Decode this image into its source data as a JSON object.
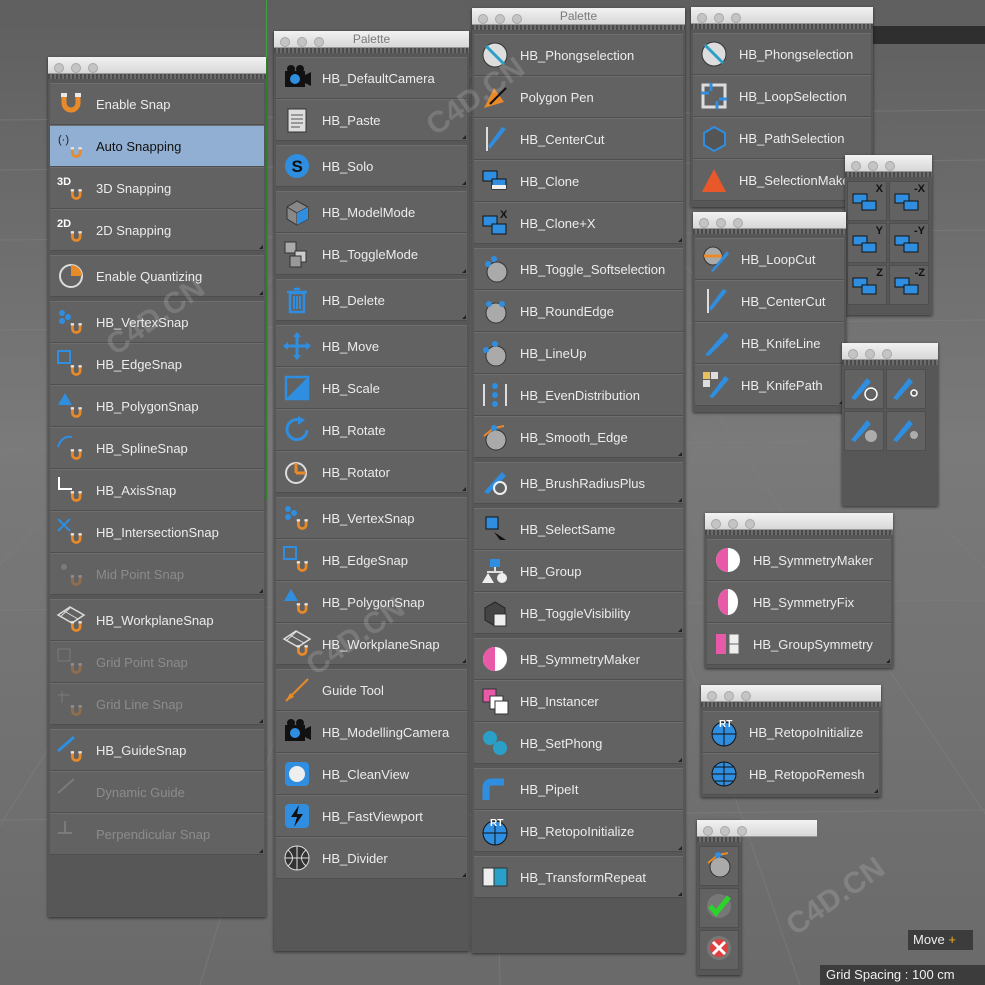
{
  "colors": {
    "panel": "#575757",
    "button": "#626262",
    "selected": "#91aed3",
    "label": "#ececec",
    "disabled": "#8c8c8c",
    "viewport": "#6e6e6e",
    "titlebar": "#e6e6e6"
  },
  "palettes": {
    "snap": {
      "groups": [
        [
          {
            "label": "Enable Snap",
            "icon": "magnet-icon"
          },
          {
            "label": "Auto Snapping",
            "icon": "auto-snap-icon",
            "selected": true
          },
          {
            "label": "3D Snapping",
            "icon": "snap-3d-icon"
          },
          {
            "label": "2D Snapping",
            "icon": "snap-2d-icon"
          }
        ],
        [
          {
            "label": "Enable Quantizing",
            "icon": "quantize-icon"
          }
        ],
        [
          {
            "label": "HB_VertexSnap",
            "icon": "vertex-snap-icon"
          },
          {
            "label": "HB_EdgeSnap",
            "icon": "edge-snap-icon"
          },
          {
            "label": "HB_PolygonSnap",
            "icon": "polygon-snap-icon"
          },
          {
            "label": "HB_SplineSnap",
            "icon": "spline-snap-icon"
          },
          {
            "label": "HB_AxisSnap",
            "icon": "axis-snap-icon"
          },
          {
            "label": "HB_IntersectionSnap",
            "icon": "intersection-snap-icon"
          },
          {
            "label": "Mid Point Snap",
            "icon": "midpoint-snap-icon",
            "disabled": true
          }
        ],
        [
          {
            "label": "HB_WorkplaneSnap",
            "icon": "workplane-snap-icon"
          },
          {
            "label": "Grid Point Snap",
            "icon": "grid-point-snap-icon",
            "disabled": true
          },
          {
            "label": "Grid Line Snap",
            "icon": "grid-line-snap-icon",
            "disabled": true
          }
        ],
        [
          {
            "label": "HB_GuideSnap",
            "icon": "guide-snap-icon"
          },
          {
            "label": "Dynamic Guide",
            "icon": "dynamic-guide-icon",
            "disabled": true
          },
          {
            "label": "Perpendicular Snap",
            "icon": "perpendicular-snap-icon",
            "disabled": true
          }
        ]
      ]
    },
    "palette2": {
      "title": "Palette",
      "groups": [
        [
          {
            "label": "HB_DefaultCamera",
            "icon": "camera-icon"
          },
          {
            "label": "HB_Paste",
            "icon": "paste-icon"
          }
        ],
        [
          {
            "label": "HB_Solo",
            "icon": "solo-icon"
          }
        ],
        [
          {
            "label": "HB_ModelMode",
            "icon": "cube-icon"
          },
          {
            "label": "HB_ToggleMode",
            "icon": "toggle-mode-icon"
          }
        ],
        [
          {
            "label": "HB_Delete",
            "icon": "trash-icon"
          }
        ],
        [
          {
            "label": "HB_Move",
            "icon": "move-icon"
          },
          {
            "label": "HB_Scale",
            "icon": "scale-icon"
          },
          {
            "label": "HB_Rotate",
            "icon": "rotate-icon"
          },
          {
            "label": "HB_Rotator",
            "icon": "rotator-icon"
          }
        ],
        [
          {
            "label": "HB_VertexSnap",
            "icon": "vertex-snap-icon"
          },
          {
            "label": "HB_EdgeSnap",
            "icon": "edge-snap-icon"
          },
          {
            "label": "HB_PolygonSnap",
            "icon": "polygon-snap-icon"
          },
          {
            "label": "HB_WorkplaneSnap",
            "icon": "workplane-snap-icon"
          }
        ],
        [
          {
            "label": "Guide Tool",
            "icon": "guide-tool-icon"
          },
          {
            "label": "HB_ModellingCamera",
            "icon": "camera-icon"
          },
          {
            "label": "HB_CleanView",
            "icon": "clean-view-icon"
          },
          {
            "label": "HB_FastViewport",
            "icon": "lightning-icon"
          },
          {
            "label": "HB_Divider",
            "icon": "divider-sphere-icon"
          }
        ]
      ]
    },
    "palette3": {
      "title": "Palette",
      "groups": [
        [
          {
            "label": "HB_Phongselection",
            "icon": "phong-icon"
          },
          {
            "label": "Polygon Pen",
            "icon": "polygon-pen-icon"
          },
          {
            "label": "HB_CenterCut",
            "icon": "knife-icon"
          },
          {
            "label": "HB_Clone",
            "icon": "clone-icon"
          },
          {
            "label": "HB_Clone+X",
            "icon": "clone-x-icon"
          }
        ],
        [
          {
            "label": "HB_Toggle_Softselection",
            "icon": "soft-sel-icon"
          },
          {
            "label": "HB_RoundEdge",
            "icon": "round-edge-icon"
          },
          {
            "label": "HB_LineUp",
            "icon": "line-up-icon"
          },
          {
            "label": "HB_EvenDistribution",
            "icon": "even-dist-icon"
          },
          {
            "label": "HB_Smooth_Edge",
            "icon": "smooth-edge-icon"
          }
        ],
        [
          {
            "label": "HB_BrushRadiusPlus",
            "icon": "brush-icon"
          }
        ],
        [
          {
            "label": "HB_SelectSame",
            "icon": "select-same-icon"
          },
          {
            "label": "HB_Group",
            "icon": "group-icon"
          },
          {
            "label": "HB_ToggleVisibility",
            "icon": "visibility-icon"
          }
        ],
        [
          {
            "label": "HB_SymmetryMaker",
            "icon": "symmetry-icon"
          },
          {
            "label": "HB_Instancer",
            "icon": "instancer-icon"
          },
          {
            "label": "HB_SetPhong",
            "icon": "set-phong-icon"
          }
        ],
        [
          {
            "label": "HB_PipeIt",
            "icon": "pipe-icon"
          },
          {
            "label": "HB_RetopoInitialize",
            "icon": "retopo-icon"
          }
        ],
        [
          {
            "label": "HB_TransformRepeat",
            "icon": "transform-repeat-icon"
          }
        ]
      ]
    },
    "palette4": {
      "groups": [
        [
          {
            "label": "HB_Phongselection",
            "icon": "phong-icon"
          },
          {
            "label": "HB_LoopSelection",
            "icon": "loop-selection-icon"
          },
          {
            "label": "HB_PathSelection",
            "icon": "path-selection-icon"
          },
          {
            "label": "HB_SelectionMaker",
            "icon": "selection-maker-icon"
          }
        ]
      ]
    },
    "palette5": {
      "groups": [
        [
          {
            "label": "HB_LoopCut",
            "icon": "loop-cut-icon"
          },
          {
            "label": "HB_CenterCut",
            "icon": "knife-icon"
          },
          {
            "label": "HB_KnifeLine",
            "icon": "knife-line-icon"
          },
          {
            "label": "HB_KnifePath",
            "icon": "knife-path-icon"
          }
        ]
      ]
    },
    "palette6": {
      "groups": [
        [
          {
            "label": "HB_SymmetryMaker",
            "icon": "symmetry-icon"
          },
          {
            "label": "HB_SymmetryFix",
            "icon": "symmetry-fix-icon"
          },
          {
            "label": "HB_GroupSymmetry",
            "icon": "group-symmetry-icon"
          }
        ]
      ]
    },
    "palette7": {
      "groups": [
        [
          {
            "label": "HB_RetopoInitialize",
            "icon": "retopo-icon"
          },
          {
            "label": "HB_RetopoRemesh",
            "icon": "retopo-remesh-icon"
          }
        ]
      ]
    },
    "clone_axes": {
      "letters": [
        "X",
        "-X",
        "Y",
        "-Y",
        "Z",
        "-Z"
      ]
    },
    "brushes": {
      "icons": [
        "brush-circle-icon",
        "brush-small-icon",
        "brush-soft-icon",
        "brush-soft-small-icon"
      ]
    },
    "checks": {
      "icons": [
        "smooth-edge-icon",
        "check-icon",
        "cancel-icon"
      ]
    }
  },
  "retopo_badge": "RT",
  "snap_badges": {
    "three_d": "3D",
    "two_d": "2D"
  },
  "status": {
    "move": "Move",
    "grid_spacing": "Grid Spacing : 100 cm"
  },
  "watermark": "C4D.CN"
}
